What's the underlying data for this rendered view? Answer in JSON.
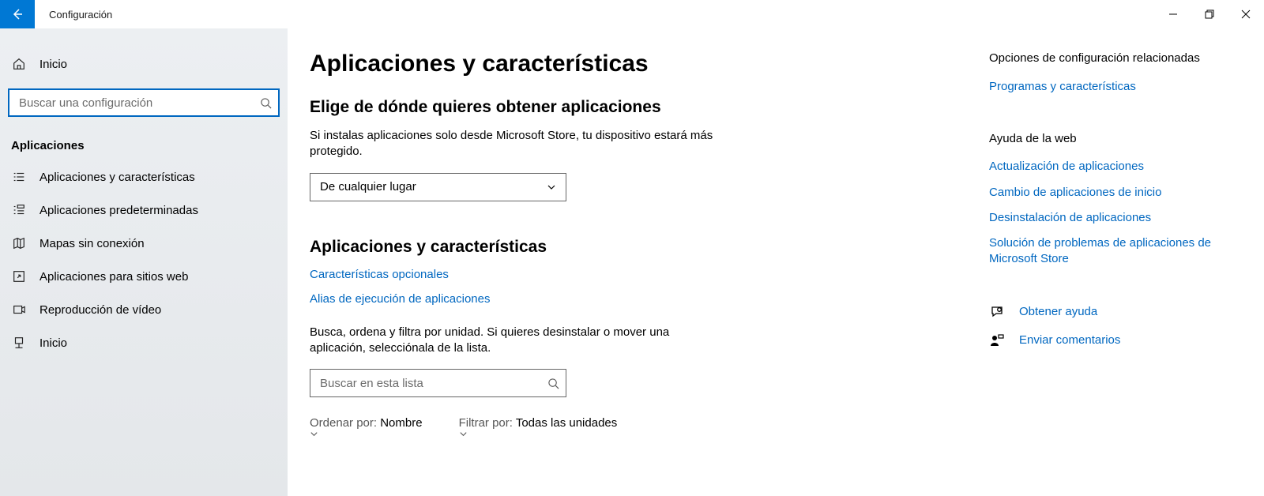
{
  "window": {
    "title": "Configuración"
  },
  "sidebar": {
    "home": "Inicio",
    "search_placeholder": "Buscar una configuración",
    "group_label": "Aplicaciones",
    "items": [
      {
        "label": "Aplicaciones y características"
      },
      {
        "label": "Aplicaciones predeterminadas"
      },
      {
        "label": "Mapas sin conexión"
      },
      {
        "label": "Aplicaciones para sitios web"
      },
      {
        "label": "Reproducción de vídeo"
      },
      {
        "label": "Inicio"
      }
    ]
  },
  "main": {
    "page_title": "Aplicaciones y características",
    "source_heading": "Elige de dónde quieres obtener aplicaciones",
    "source_body": "Si instalas aplicaciones solo desde Microsoft Store, tu dispositivo estará más protegido.",
    "source_selected": "De cualquier lugar",
    "apps_heading": "Aplicaciones y características",
    "links": {
      "optional": "Características opcionales",
      "alias": "Alias de ejecución de aplicaciones"
    },
    "search_body": "Busca, ordena y filtra por unidad. Si quieres desinstalar o mover una aplicación, selecciónala de la lista.",
    "list_search_placeholder": "Buscar en esta lista",
    "sort_label": "Ordenar por:",
    "sort_value": "Nombre",
    "filter_label": "Filtrar por:",
    "filter_value": "Todas las unidades"
  },
  "right": {
    "related_heading": "Opciones de configuración relacionadas",
    "related_link": "Programas y características",
    "web_help_heading": "Ayuda de la web",
    "web_help_links": [
      "Actualización de aplicaciones",
      "Cambio de aplicaciones de inicio",
      "Desinstalación de aplicaciones",
      "Solución de problemas de aplicaciones de Microsoft Store"
    ],
    "get_help": "Obtener ayuda",
    "feedback": "Enviar comentarios"
  }
}
